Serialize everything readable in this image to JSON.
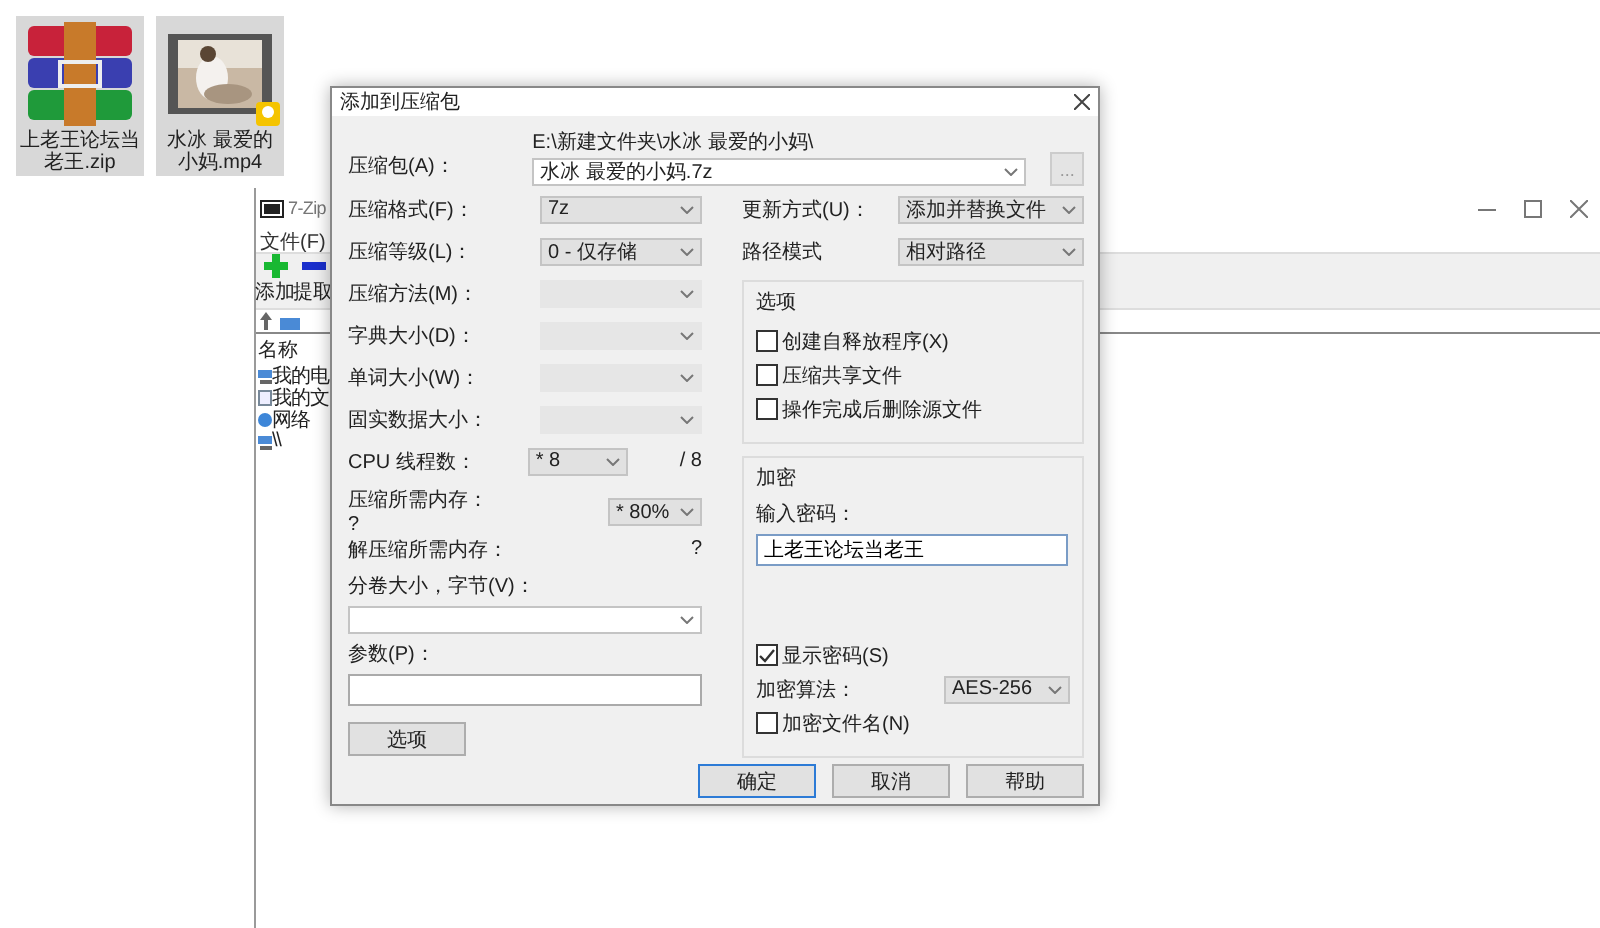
{
  "desktop_icons": [
    {
      "kind": "archive",
      "label": "上老王论坛当老王.zip"
    },
    {
      "kind": "video",
      "label": "水冰 最爱的小妈.mp4"
    }
  ],
  "background_window": {
    "title": "7-Zip",
    "menu": [
      "文件(F)"
    ],
    "toolbar": [
      {
        "kind": "add",
        "label": "添加"
      },
      {
        "kind": "extract",
        "label": "提取"
      }
    ],
    "list_header": "名称",
    "items": [
      {
        "kind": "computer",
        "label": "我的电"
      },
      {
        "kind": "documents",
        "label": "我的文"
      },
      {
        "kind": "network",
        "label": "网络"
      },
      {
        "kind": "computer",
        "label": "\\\\"
      }
    ]
  },
  "dialog": {
    "title": "添加到压缩包",
    "archive": {
      "label": "压缩包(A)：",
      "path": "E:\\新建文件夹\\水冰 最爱的小妈\\",
      "value": "水冰 最爱的小妈.7z",
      "browse": "..."
    },
    "left_rows": [
      {
        "label": "压缩格式(F)：",
        "value": "7z",
        "disabled": false
      },
      {
        "label": "压缩等级(L)：",
        "value": "0 - 仅存储",
        "disabled": false
      },
      {
        "label": "压缩方法(M)：",
        "disabled": true
      },
      {
        "label": "字典大小(D)：",
        "disabled": true
      },
      {
        "label": "单词大小(W)：",
        "disabled": true
      },
      {
        "label": "固实数据大小：",
        "disabled": true
      }
    ],
    "threads": {
      "label": "CPU 线程数：",
      "value": "* 8",
      "max": "/ 8"
    },
    "memory": {
      "label": "压缩所需内存：",
      "note": "?",
      "value": "* 80%"
    },
    "decompress": {
      "label": "解压缩所需内存：",
      "value": "?"
    },
    "volume": {
      "label": "分卷大小，字节(V)："
    },
    "params": {
      "label": "参数(P)："
    },
    "options_button": "选项",
    "update": {
      "label": "更新方式(U)：",
      "value": "添加并替换文件"
    },
    "path_mode": {
      "label": "路径模式",
      "value": "相对路径"
    },
    "options_group": {
      "title": "选项",
      "items": [
        {
          "label": "创建自释放程序(X)",
          "checked": false
        },
        {
          "label": "压缩共享文件",
          "checked": false
        },
        {
          "label": "操作完成后删除源文件",
          "checked": false
        }
      ]
    },
    "encryption": {
      "title": "加密",
      "password_label": "输入密码：",
      "password": "上老王论坛当老王",
      "show_password": {
        "label": "显示密码(S)",
        "checked": true
      },
      "method_label": "加密算法：",
      "method": "AES-256",
      "encrypt_names": {
        "label": "加密文件名(N)",
        "checked": false
      }
    },
    "buttons": [
      {
        "label": "确定",
        "default": true
      },
      {
        "label": "取消",
        "default": false
      },
      {
        "label": "帮助",
        "default": false
      }
    ]
  }
}
